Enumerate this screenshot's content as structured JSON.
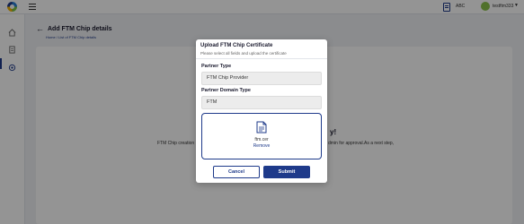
{
  "header": {
    "org_label": "ABC",
    "username": "testftm333"
  },
  "page": {
    "title": "Add FTM Chip details",
    "breadcrumb": "Home / List of FTM Chip details"
  },
  "background_card": {
    "heading": "y!",
    "text_left": "FTM Chip creation",
    "text_right": "dmin for approval.As a next step,"
  },
  "modal": {
    "title": "Upload FTM Chip Certificate",
    "subtitle": "Please select all fields and upload the certificate",
    "partner_type_label": "Partner Type",
    "partner_type_value": "FTM Chip Provider",
    "partner_domain_label": "Partner Domain Type",
    "partner_domain_value": "FTM",
    "uploaded_file": "ftm.cer",
    "remove_label": "Remove",
    "cancel_label": "Cancel",
    "submit_label": "Submit"
  },
  "icons": {
    "logo": "logo-icon",
    "menu": "hamburger-icon",
    "document": "document-icon",
    "avatar": "avatar-icon",
    "chevron": "chevron-down-icon",
    "home": "home-icon",
    "file": "file-icon",
    "settings": "gear-icon",
    "back": "arrow-left-icon"
  },
  "colors": {
    "primary": "#1e3a8a",
    "overlay": "rgba(0,0,0,0.42)"
  }
}
